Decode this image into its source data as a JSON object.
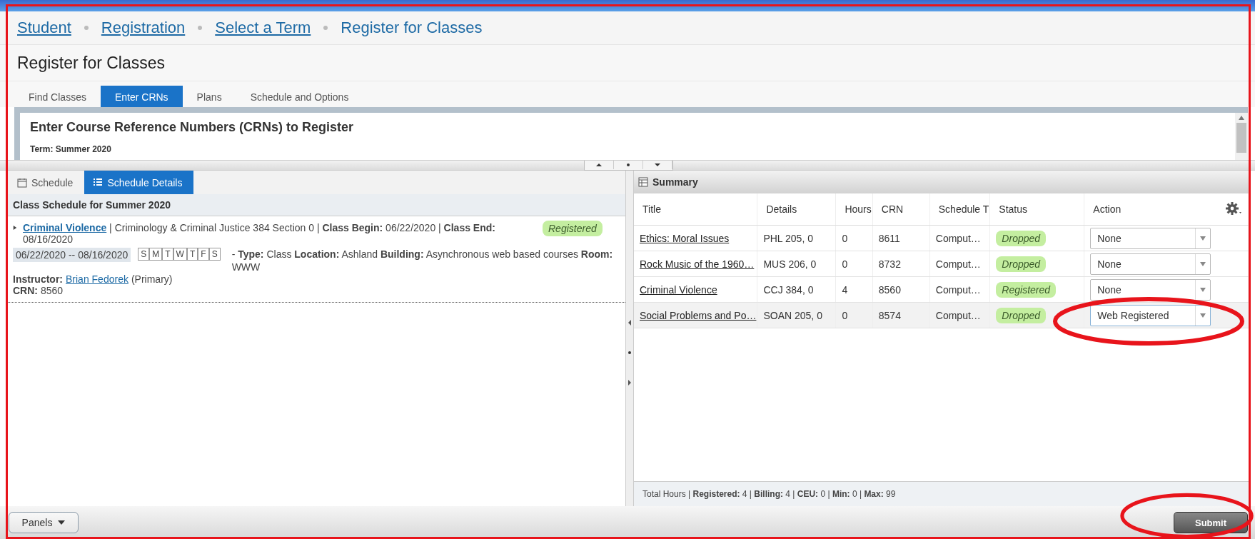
{
  "breadcrumbs": [
    {
      "label": "Student",
      "link": true
    },
    {
      "label": "Registration",
      "link": true
    },
    {
      "label": "Select a Term",
      "link": true
    },
    {
      "label": "Register for Classes",
      "link": false
    }
  ],
  "page_title": "Register for Classes",
  "tabs": [
    {
      "label": "Find Classes",
      "selected": false
    },
    {
      "label": "Enter CRNs",
      "selected": true
    },
    {
      "label": "Plans",
      "selected": false
    },
    {
      "label": "Schedule and Options",
      "selected": false
    }
  ],
  "crn_panel": {
    "title": "Enter Course Reference Numbers (CRNs) to Register",
    "term": "Term: Summer 2020"
  },
  "schedule_panel": {
    "tabs": [
      {
        "label": "Schedule",
        "kind": "calendar",
        "selected": false
      },
      {
        "label": "Schedule Details",
        "kind": "list",
        "selected": true
      }
    ],
    "heading": "Class Schedule for Summer 2020",
    "classes": [
      {
        "title": "Criminal Violence",
        "summary": " | Criminology & Criminal Justice 384 Section 0 | **Class Begin:** 06/22/2020 | **Class End:** 08/16/2020",
        "status": "Registered",
        "date_range": "06/22/2020 -- 08/16/2020",
        "days": [
          "S",
          "M",
          "T",
          "W",
          "T",
          "F",
          "S"
        ],
        "meeting": "- **Type:** Class **Location:** Ashland **Building:** Asynchronous web based courses **Room:** WWW",
        "instructor_label": "Instructor:",
        "instructor": "Brian Fedorek",
        "instructor_role": "(Primary)",
        "crn": "**CRN:** 8560"
      }
    ]
  },
  "summary_panel": {
    "title": "Summary",
    "columns": [
      "Title",
      "Details",
      "Hours",
      "CRN",
      "Schedule T",
      "Status",
      "Action"
    ],
    "rows": [
      {
        "title": "Ethics: Moral Issues",
        "details": "PHL 205, 0",
        "hours": "0",
        "crn": "8611",
        "schedule_type": "Comput…",
        "status": "Dropped",
        "action": "None",
        "selected": false
      },
      {
        "title": "Rock Music of the 1960…",
        "details": "MUS 206, 0",
        "hours": "0",
        "crn": "8732",
        "schedule_type": "Comput…",
        "status": "Dropped",
        "action": "None",
        "selected": false
      },
      {
        "title": "Criminal Violence",
        "details": "CCJ 384, 0",
        "hours": "4",
        "crn": "8560",
        "schedule_type": "Comput…",
        "status": "Registered",
        "action": "None",
        "selected": false
      },
      {
        "title": "Social Problems and Po…",
        "details": "SOAN 205, 0",
        "hours": "0",
        "crn": "8574",
        "schedule_type": "Comput…",
        "status": "Dropped",
        "action": "Web Registered",
        "selected": true
      }
    ],
    "totals": "Total Hours | **Registered:** 4 | **Billing:** 4 | **CEU:** 0 | **Min:** 0 | **Max:** 99"
  },
  "footer": {
    "panels_button": "Panels",
    "submit_button": "Submit"
  }
}
